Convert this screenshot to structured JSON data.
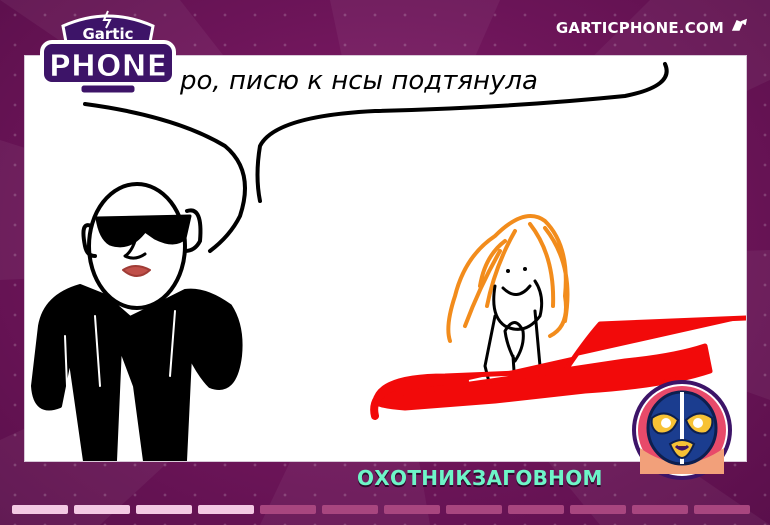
{
  "brand": {
    "logo_top": "Gartic",
    "logo_main": "PHONE",
    "site": "GARTICPHONE.COM"
  },
  "drawing": {
    "caption_text": "ро, писю к нсы подтянула",
    "colors": {
      "ink": "#000000",
      "hair": "#f28c1c",
      "car": "#f20a0a",
      "lips": "#c0504a",
      "background": "#ffffff"
    }
  },
  "player": {
    "name": "ОХОТНИКЗАГОВНОМ",
    "avatar": "luchador-mask-icon"
  },
  "progress": {
    "total": 12,
    "completed": 4
  },
  "theme": {
    "accent": "#6ef5c8",
    "bg": "#6d1559"
  }
}
